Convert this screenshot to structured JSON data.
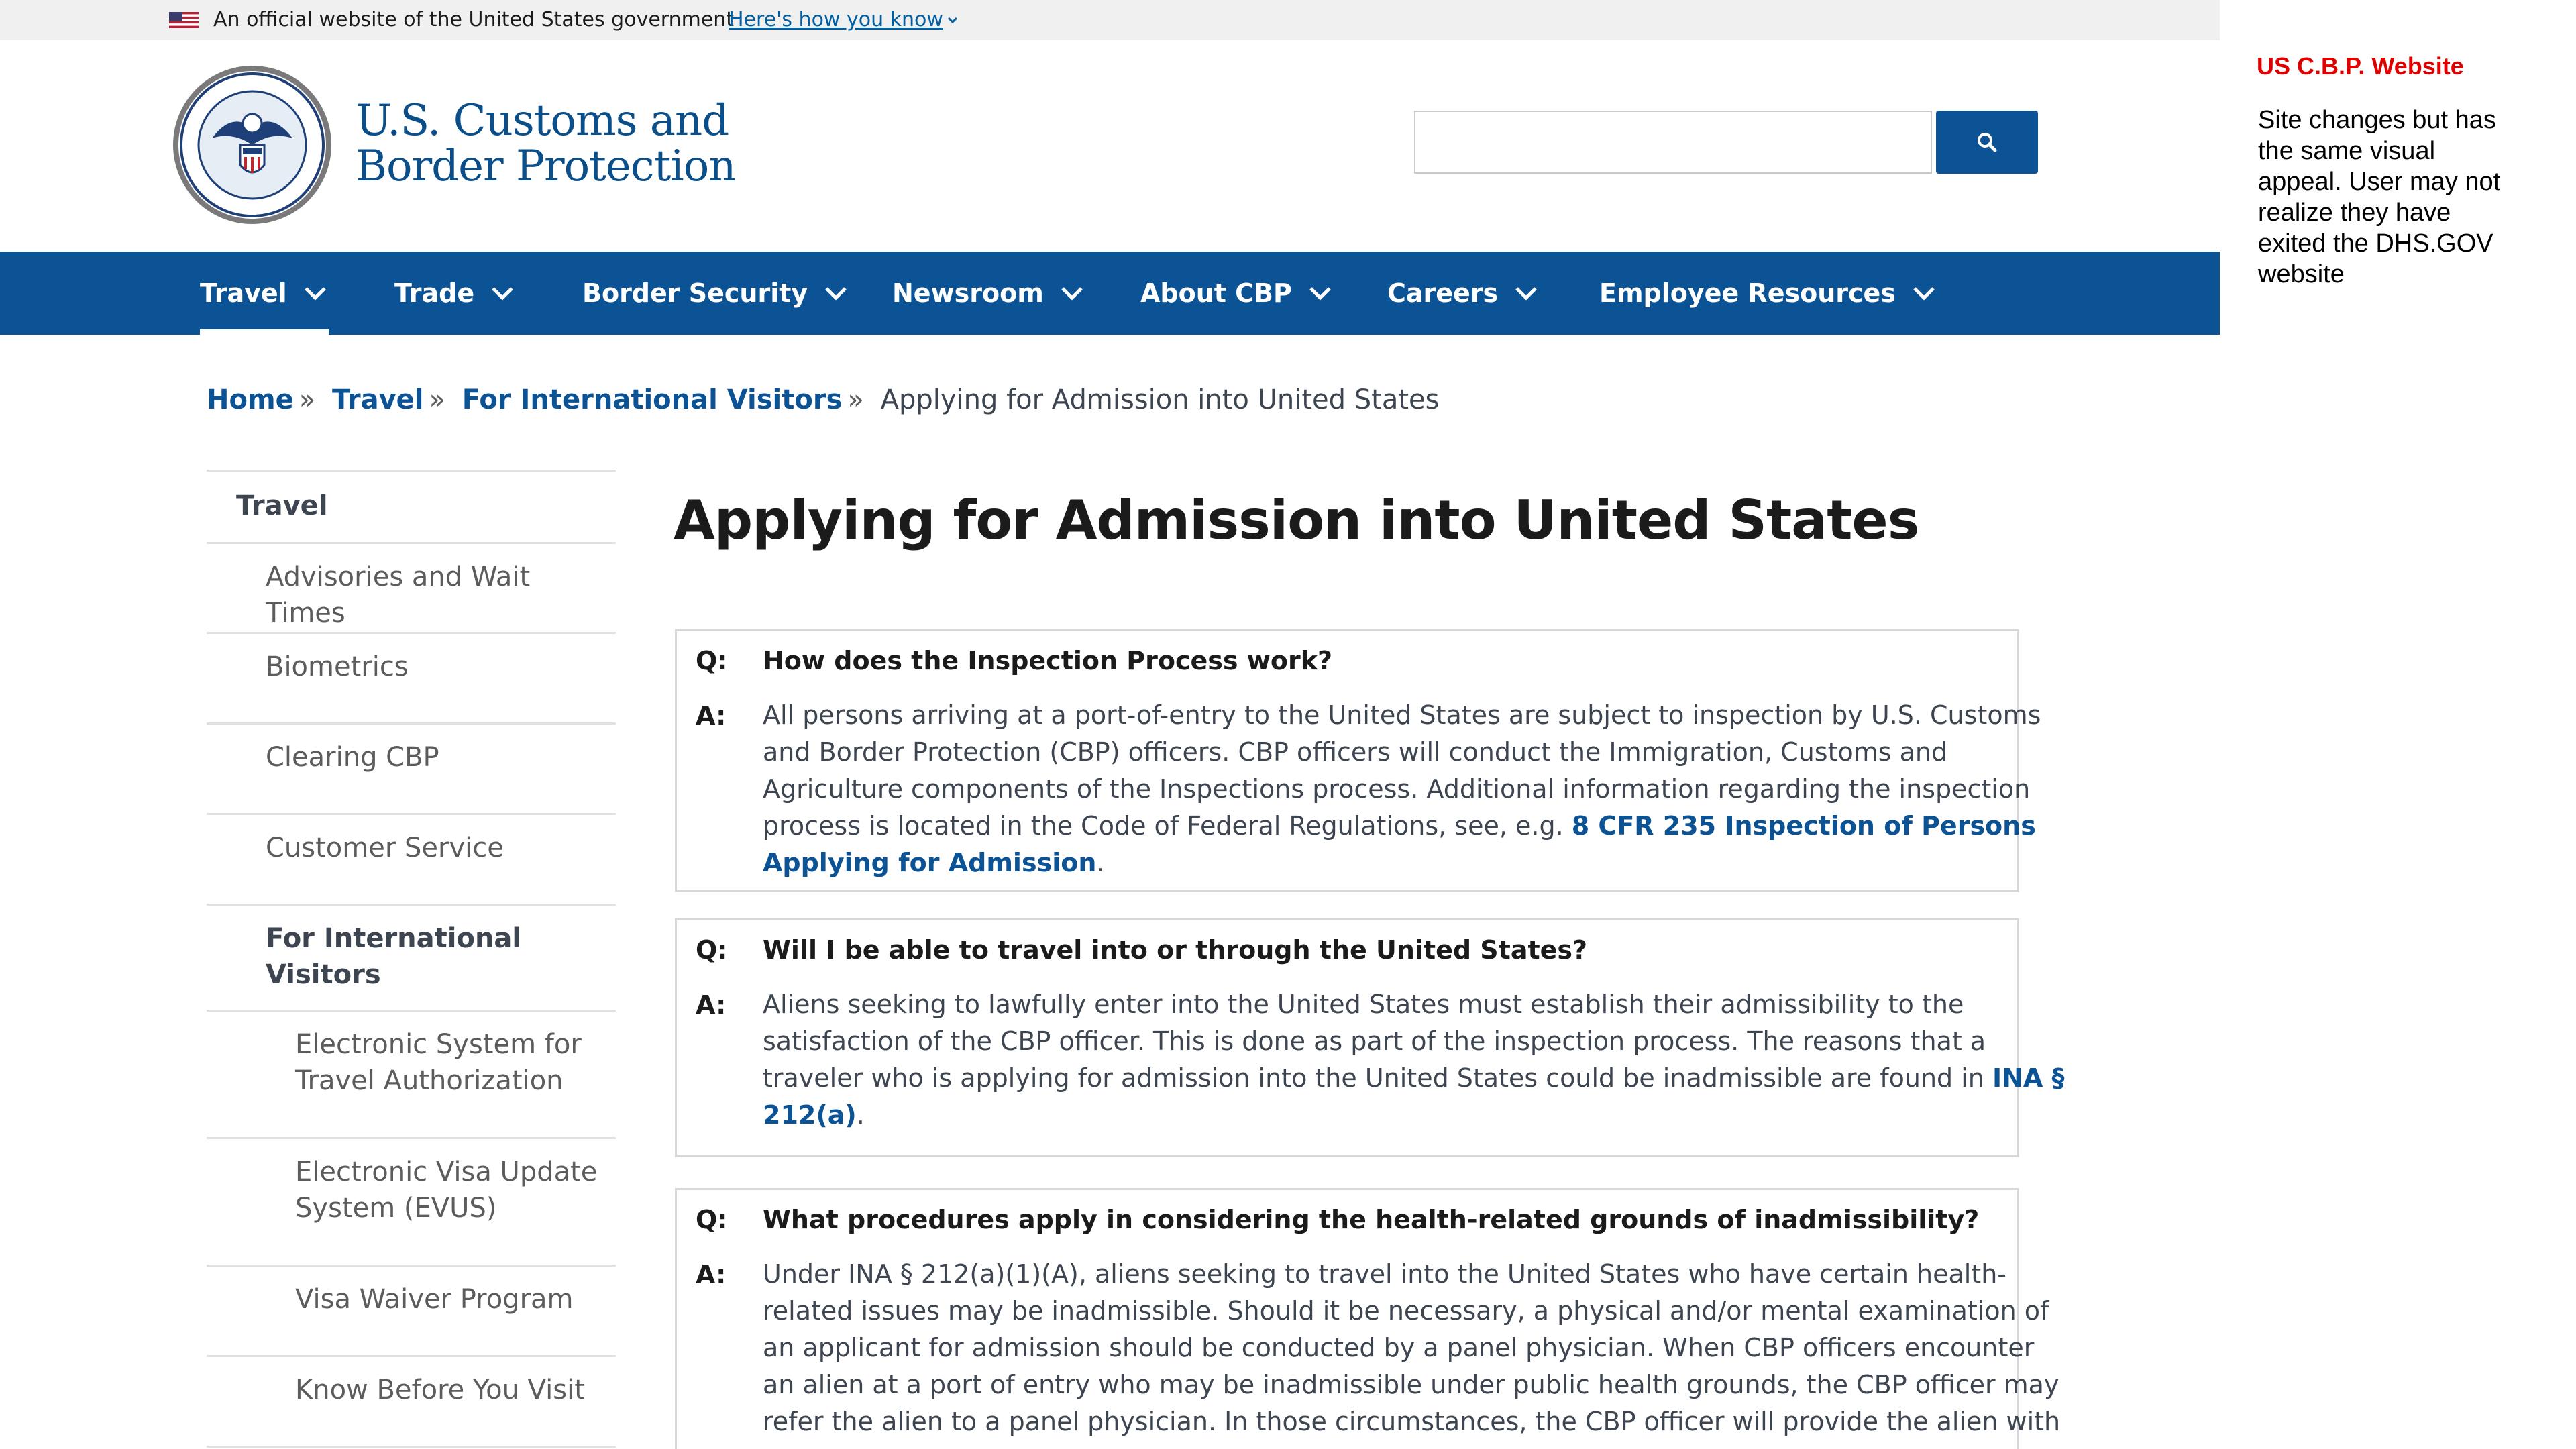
{
  "gov_banner": {
    "text": "An official website of the United States government",
    "link": "Here's how you know"
  },
  "header": {
    "site_name_line1": "U.S. Customs and",
    "site_name_line2": "Border Protection",
    "search_placeholder": "",
    "search_icon": "search-icon"
  },
  "nav": {
    "items": [
      "Travel",
      "Trade",
      "Border Security",
      "Newsroom",
      "About CBP",
      "Careers",
      "Employee Resources"
    ],
    "active": "Travel"
  },
  "breadcrumb": {
    "items": [
      "Home",
      "Travel",
      "For International Visitors"
    ],
    "separator": "»",
    "current": "Applying for Admission into United States"
  },
  "sidebar": {
    "section": "Travel",
    "items": [
      "Advisories and Wait Times",
      "Biometrics",
      "Clearing CBP",
      "Customer Service"
    ],
    "active_group": [
      "For International",
      "Visitors"
    ],
    "subitems": [
      [
        "Electronic System for",
        "Travel Authorization"
      ],
      [
        "Electronic Visa Update",
        "System (EVUS)"
      ],
      [
        "Visa Waiver Program"
      ],
      [
        "Know Before You Visit"
      ]
    ]
  },
  "main": {
    "title": "Applying for Admission into United States",
    "q_label": "Q:",
    "a_label": "A:",
    "qa": [
      {
        "question": "How does the Inspection Process work?",
        "answer_lines": [
          "All persons arriving at a port-of-entry to the United States are subject to inspection by U.S. Customs",
          "and Border Protection (CBP) officers.  CBP officers will conduct the Immigration, Customs and",
          "Agriculture components of the Inspections process. Additional information regarding the inspection",
          "process is located in the Code of Federal Regulations, see, e.g. "
        ],
        "link_line1": "8 CFR 235 Inspection of Persons",
        "link_line2": "Applying for Admission",
        "answer_end": "."
      },
      {
        "question": "Will I be able to travel into or through the United States?",
        "answer_lines": [
          "Aliens seeking to lawfully enter into the United States must establish their admissibility to the",
          "satisfaction of the CBP officer. This is done as part of the inspection process. The reasons that a",
          "traveler who is applying for admission into the United States could be inadmissible are found in "
        ],
        "link_line1": "INA §",
        "link_line2": "212(a)",
        "answer_end": "."
      },
      {
        "question": "What procedures apply in considering the health-related grounds of inadmissibility?",
        "answer_lines": [
          "Under INA § 212(a)(1)(A), aliens seeking to travel into the United States who have certain health-",
          "related issues may be inadmissible. Should it be necessary, a physical and/or mental examination of",
          "an applicant for admission should be conducted by a panel physician. When CBP officers encounter",
          "an alien at a port of entry who may be inadmissible under public health grounds, the CBP officer may",
          "refer the alien to a panel physician. In those circumstances, the CBP officer will provide the alien with"
        ]
      }
    ]
  },
  "annotation": {
    "title": "US C.B.P. Website",
    "lines": [
      "Site changes but has",
      "the same visual",
      "appeal. User may not",
      "realize they have",
      "exited the DHS.GOV",
      "website"
    ]
  },
  "colors": {
    "nav_bg": "#0b5394",
    "link": "#0b5394",
    "banner_bg": "#f0f0f0",
    "annotation_title": "#e00000"
  }
}
